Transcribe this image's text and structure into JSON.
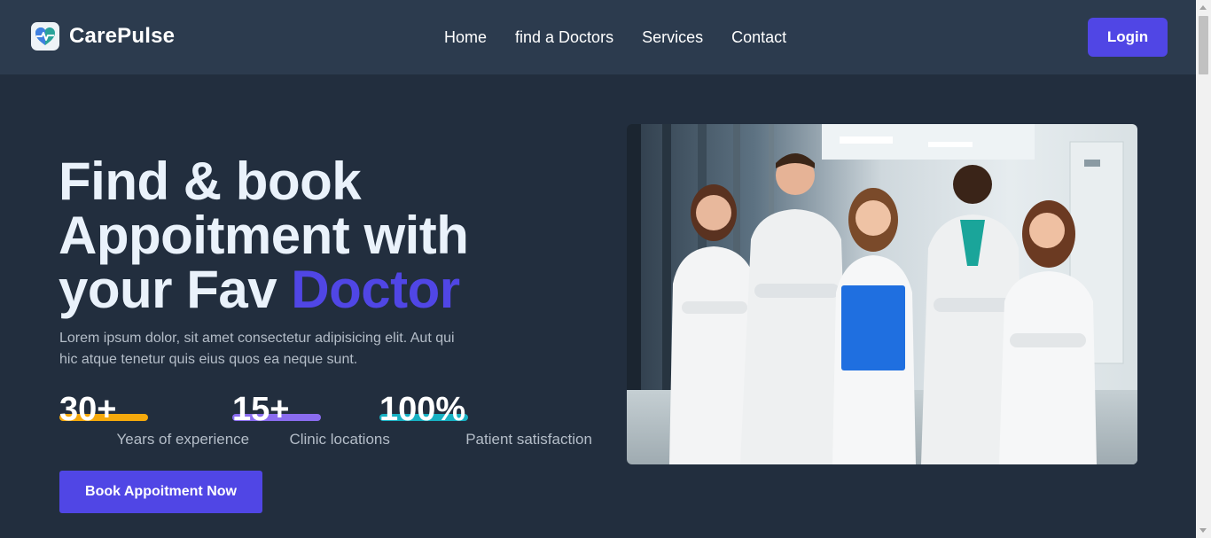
{
  "brand": {
    "name": "CarePulse",
    "logo_icon": "heart-pulse-icon"
  },
  "nav": {
    "links": [
      {
        "label": "Home"
      },
      {
        "label": "find a Doctors"
      },
      {
        "label": "Services"
      },
      {
        "label": "Contact"
      }
    ],
    "login_label": "Login"
  },
  "hero": {
    "title_line1": "Find & book",
    "title_line2": "Appoitment with",
    "title_line3_prefix": "your Fav ",
    "title_line3_accent": "Doctor",
    "description": "Lorem ipsum dolor, sit amet consectetur adipisicing elit. Aut qui hic atque tenetur quis eius quos ea neque sunt.",
    "stats": [
      {
        "value": "30+",
        "label": "Years of experience",
        "bar_color": "#f5a90c"
      },
      {
        "value": "15+",
        "label": "Clinic locations",
        "bar_color": "#8a6cf0"
      },
      {
        "value": "100%",
        "label": "Patient satisfaction",
        "bar_color": "#17b1c3"
      }
    ],
    "cta_label": "Book Appoitment Now",
    "image_alt": "Group of doctors in hospital corridor"
  },
  "colors": {
    "accent": "#5046e5",
    "nav_bg": "#2c3b4e",
    "page_bg": "#222e3e"
  }
}
